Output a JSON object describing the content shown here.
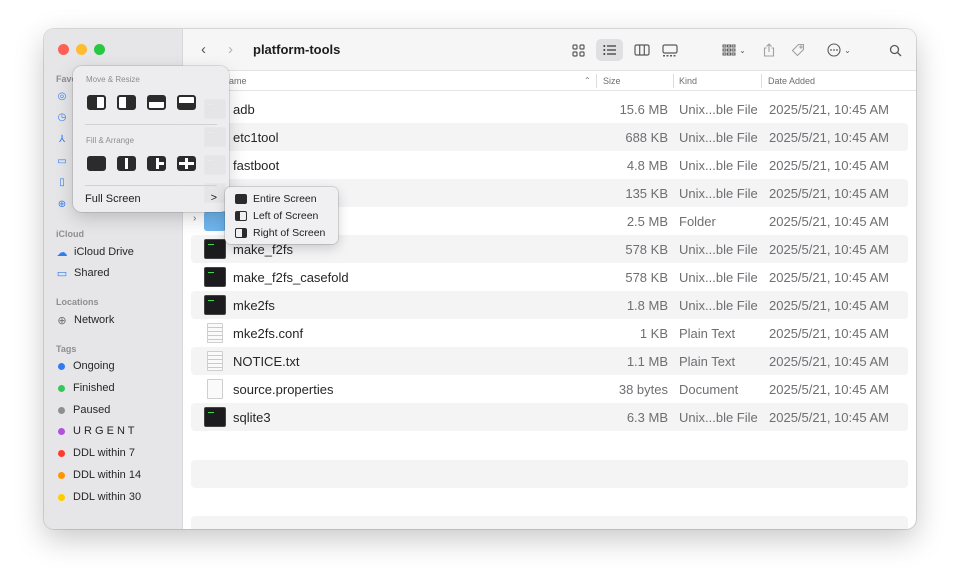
{
  "window": {
    "title": "platform-tools"
  },
  "sidebar": {
    "favorites_label": "Favo",
    "icloud_label": "iCloud",
    "icloud_items": [
      "iCloud Drive",
      "Shared"
    ],
    "locations_label": "Locations",
    "location_items": [
      "Network"
    ],
    "tags_label": "Tags",
    "tags": [
      {
        "label": "Ongoing",
        "color": "#2f7cf6"
      },
      {
        "label": "Finished",
        "color": "#34c759"
      },
      {
        "label": "Paused",
        "color": "#8e8e93"
      },
      {
        "label": "U R G E N T",
        "color": "#af52de"
      },
      {
        "label": "DDL within 7",
        "color": "#ff3b30"
      },
      {
        "label": "DDL within 14",
        "color": "#ff9500"
      },
      {
        "label": "DDL within 30",
        "color": "#ffcc00"
      }
    ]
  },
  "columns": {
    "name": "ame",
    "size": "Size",
    "kind": "Kind",
    "date_added": "Date Added"
  },
  "files": [
    {
      "name": "adb",
      "size": "15.6 MB",
      "kind": "Unix...ble File",
      "date": "2025/5/21, 10:45 AM",
      "icon": "exec"
    },
    {
      "name": "etc1tool",
      "size": "688 KB",
      "kind": "Unix...ble File",
      "date": "2025/5/21, 10:45 AM",
      "icon": "exec"
    },
    {
      "name": "fastboot",
      "size": "4.8 MB",
      "kind": "Unix...ble File",
      "date": "2025/5/21, 10:45 AM",
      "icon": "exec"
    },
    {
      "name": "",
      "size": "135 KB",
      "kind": "Unix...ble File",
      "date": "2025/5/21, 10:45 AM",
      "icon": "exec"
    },
    {
      "name": "",
      "size": "2.5 MB",
      "kind": "Folder",
      "date": "2025/5/21, 10:45 AM",
      "icon": "folder"
    },
    {
      "name": "make_f2fs",
      "size": "578 KB",
      "kind": "Unix...ble File",
      "date": "2025/5/21, 10:45 AM",
      "icon": "exec"
    },
    {
      "name": "make_f2fs_casefold",
      "size": "578 KB",
      "kind": "Unix...ble File",
      "date": "2025/5/21, 10:45 AM",
      "icon": "exec"
    },
    {
      "name": "mke2fs",
      "size": "1.8 MB",
      "kind": "Unix...ble File",
      "date": "2025/5/21, 10:45 AM",
      "icon": "exec"
    },
    {
      "name": "mke2fs.conf",
      "size": "1 KB",
      "kind": "Plain Text",
      "date": "2025/5/21, 10:45 AM",
      "icon": "text"
    },
    {
      "name": "NOTICE.txt",
      "size": "1.1 MB",
      "kind": "Plain Text",
      "date": "2025/5/21, 10:45 AM",
      "icon": "text"
    },
    {
      "name": "source.properties",
      "size": "38 bytes",
      "kind": "Document",
      "date": "2025/5/21, 10:45 AM",
      "icon": "doc"
    },
    {
      "name": "sqlite3",
      "size": "6.3 MB",
      "kind": "Unix...ble File",
      "date": "2025/5/21, 10:45 AM",
      "icon": "exec"
    }
  ],
  "popover": {
    "move_resize_label": "Move & Resize",
    "fill_arrange_label": "Fill & Arrange",
    "full_screen_label": "Full Screen",
    "chevron": ">"
  },
  "submenu": {
    "items": [
      "Entire Screen",
      "Left of Screen",
      "Right of Screen"
    ]
  },
  "colors": {
    "close": "#fe5f57",
    "minimize": "#febc2e",
    "zoom": "#28c840",
    "accent": "#2f7cf6"
  }
}
